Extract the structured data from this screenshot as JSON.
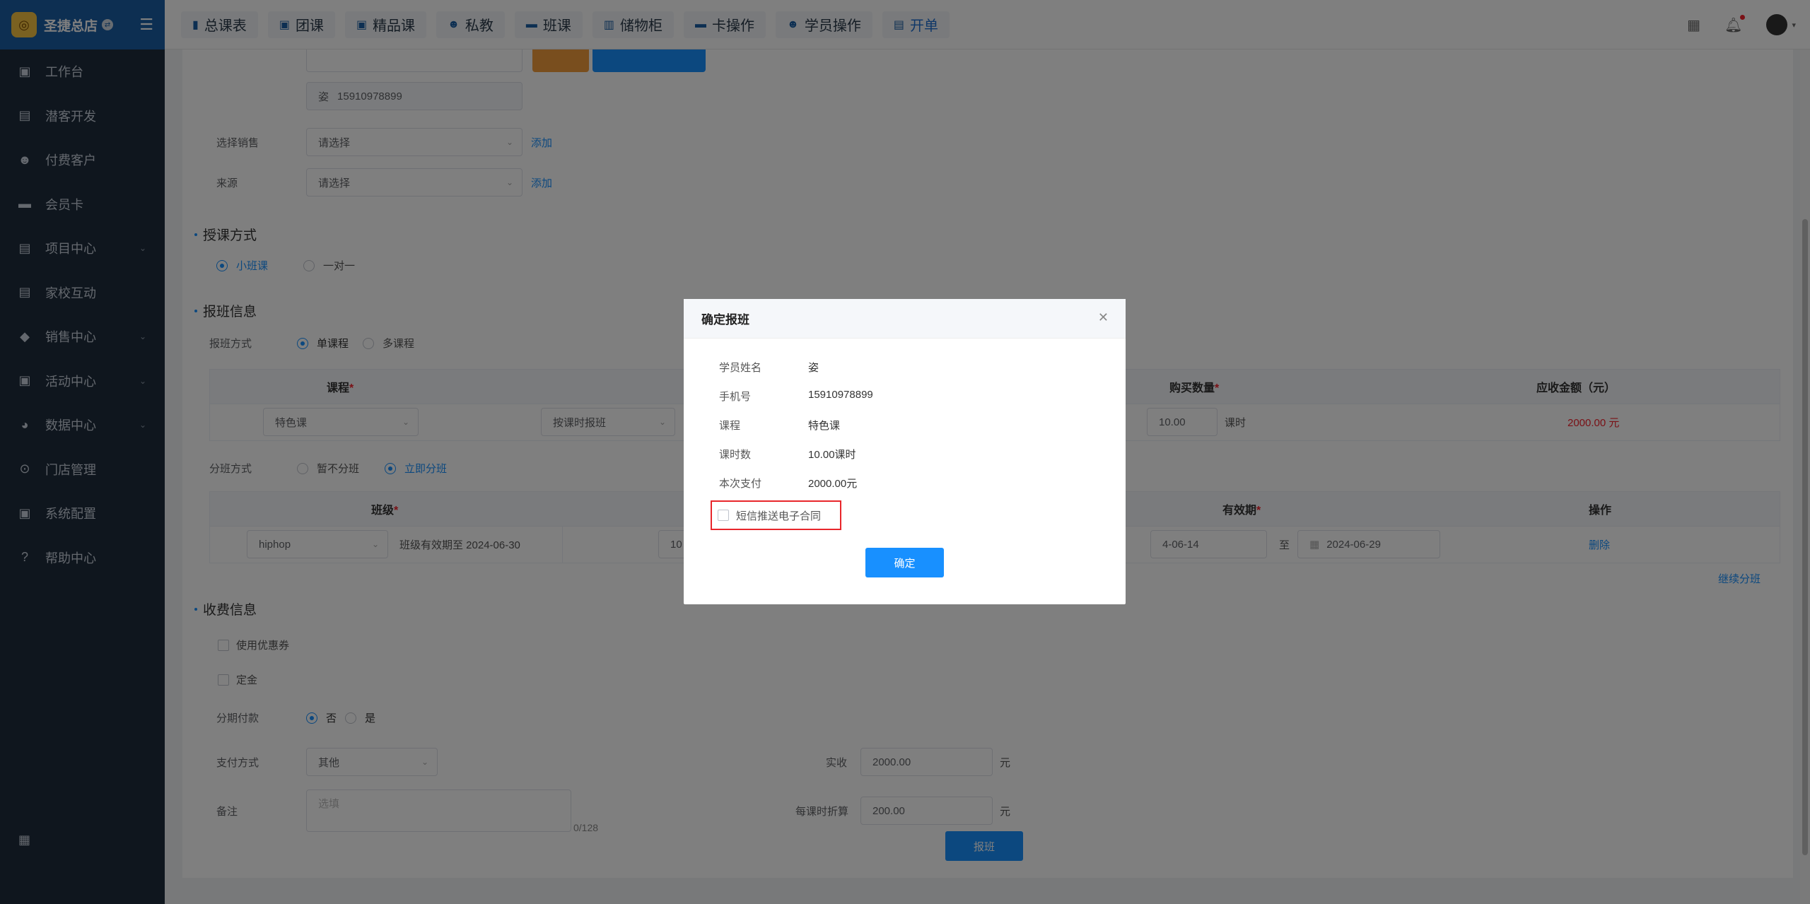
{
  "sidebar": {
    "brand": "圣捷总店",
    "items": [
      {
        "label": "工作台",
        "has_children": false
      },
      {
        "label": "潜客开发",
        "has_children": false
      },
      {
        "label": "付费客户",
        "has_children": false
      },
      {
        "label": "会员卡",
        "has_children": false
      },
      {
        "label": "项目中心",
        "has_children": true
      },
      {
        "label": "家校互动",
        "has_children": false
      },
      {
        "label": "销售中心",
        "has_children": true
      },
      {
        "label": "活动中心",
        "has_children": true
      },
      {
        "label": "数据中心",
        "has_children": true
      },
      {
        "label": "门店管理",
        "has_children": false
      },
      {
        "label": "系统配置",
        "has_children": false
      },
      {
        "label": "帮助中心",
        "has_children": false
      }
    ]
  },
  "topbar": {
    "tabs": [
      "总课表",
      "团课",
      "精品课",
      "私教",
      "班课",
      "储物柜",
      "卡操作",
      "学员操作",
      "开单"
    ]
  },
  "form": {
    "phone_display": "15910978899",
    "phone_prefix": "姿",
    "sales_label": "选择销售",
    "sales_placeholder": "请选择",
    "source_label": "来源",
    "source_placeholder": "请选择",
    "add_link": "添加",
    "teaching_title": "授课方式",
    "teaching_small": "小班课",
    "teaching_one": "一对一",
    "enroll_title": "报班信息",
    "enroll_mode_label": "报班方式",
    "enroll_single": "单课程",
    "enroll_multi": "多课程",
    "course_header": "课程",
    "qty_header": "购买数量",
    "amount_header": "应收金额（元）",
    "course_value": "特色课",
    "course_mode": "按课时报班",
    "qty_value": "10.00",
    "qty_unit": "课时",
    "amount_value": "2000.00 元",
    "split_label": "分班方式",
    "split_no": "暂不分班",
    "split_now": "立即分班",
    "class_header": "班级",
    "validity_header": "有效期",
    "action_header": "操作",
    "class_value": "hiphop",
    "class_validity": "班级有效期至 2024-06-30",
    "class_col3_partial": "10",
    "date_start_partial": "4-06-14",
    "date_to": "至",
    "date_end": "2024-06-29",
    "delete_link": "删除",
    "continue_link": "继续分班",
    "fee_title": "收费信息",
    "coupon": "使用优惠券",
    "deposit": "定金",
    "installment_label": "分期付款",
    "installment_no": "否",
    "installment_yes": "是",
    "pay_method_label": "支付方式",
    "pay_method_value": "其他",
    "actual_label": "实收",
    "actual_value": "2000.00",
    "yuan": "元",
    "remark_label": "备注",
    "remark_placeholder": "选填",
    "remark_counter": "0/128",
    "per_lesson_label": "每课时折算",
    "per_lesson_value": "200.00",
    "submit_button": "报班"
  },
  "modal": {
    "title": "确定报班",
    "rows": [
      {
        "key": "学员姓名",
        "value": "姿"
      },
      {
        "key": "手机号",
        "value": "15910978899"
      },
      {
        "key": "课程",
        "value": "特色课"
      },
      {
        "key": "课时数",
        "value": "10.00课时"
      },
      {
        "key": "本次支付",
        "value": "2000.00元"
      }
    ],
    "sms_checkbox": "短信推送电子合同",
    "sms_checked": false,
    "confirm_button": "确定"
  },
  "colors": {
    "sidebar_bg": "#1f2d3d",
    "brand_bg": "#1a5fa5",
    "accent": "#1890ff",
    "highlight": "#e8262b"
  }
}
